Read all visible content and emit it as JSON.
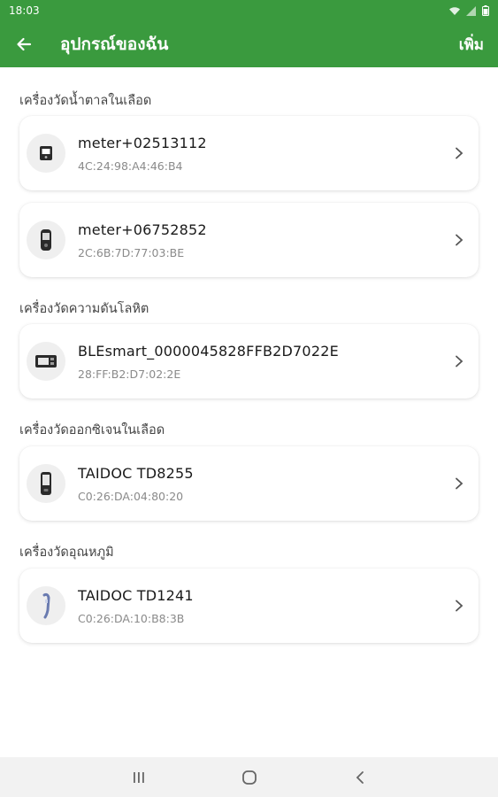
{
  "status_bar": {
    "time": "18:03"
  },
  "appbar": {
    "title": "อุปกรณ์ของฉัน",
    "add_label": "เพิ่ม"
  },
  "sections": [
    {
      "title": "เครื่องวัดน้ำตาลในเลือด"
    },
    {
      "title": "เครื่องวัดความดันโลหิต"
    },
    {
      "title": "เครื่องวัดออกซิเจนในเลือด"
    },
    {
      "title": "เครื่องวัดอุณหภูมิ"
    }
  ],
  "devices": [
    {
      "name": "meter+02513112",
      "mac": "4C:24:98:A4:46:B4",
      "icon": "glucose-meter-icon"
    },
    {
      "name": "meter+06752852",
      "mac": "2C:6B:7D:77:03:BE",
      "icon": "glucose-meter-icon"
    },
    {
      "name": "BLEsmart_0000045828FFB2D7022E",
      "mac": "28:FF:B2:D7:02:2E",
      "icon": "blood-pressure-monitor-icon"
    },
    {
      "name": "TAIDOC  TD8255",
      "mac": "C0:26:DA:04:80:20",
      "icon": "pulse-oximeter-icon"
    },
    {
      "name": "TAIDOC  TD1241",
      "mac": "C0:26:DA:10:B8:3B",
      "icon": "thermometer-icon"
    }
  ],
  "colors": {
    "primary": "#3a9a3e",
    "background": "#ffffff",
    "navbar": "#f2f2f2"
  }
}
